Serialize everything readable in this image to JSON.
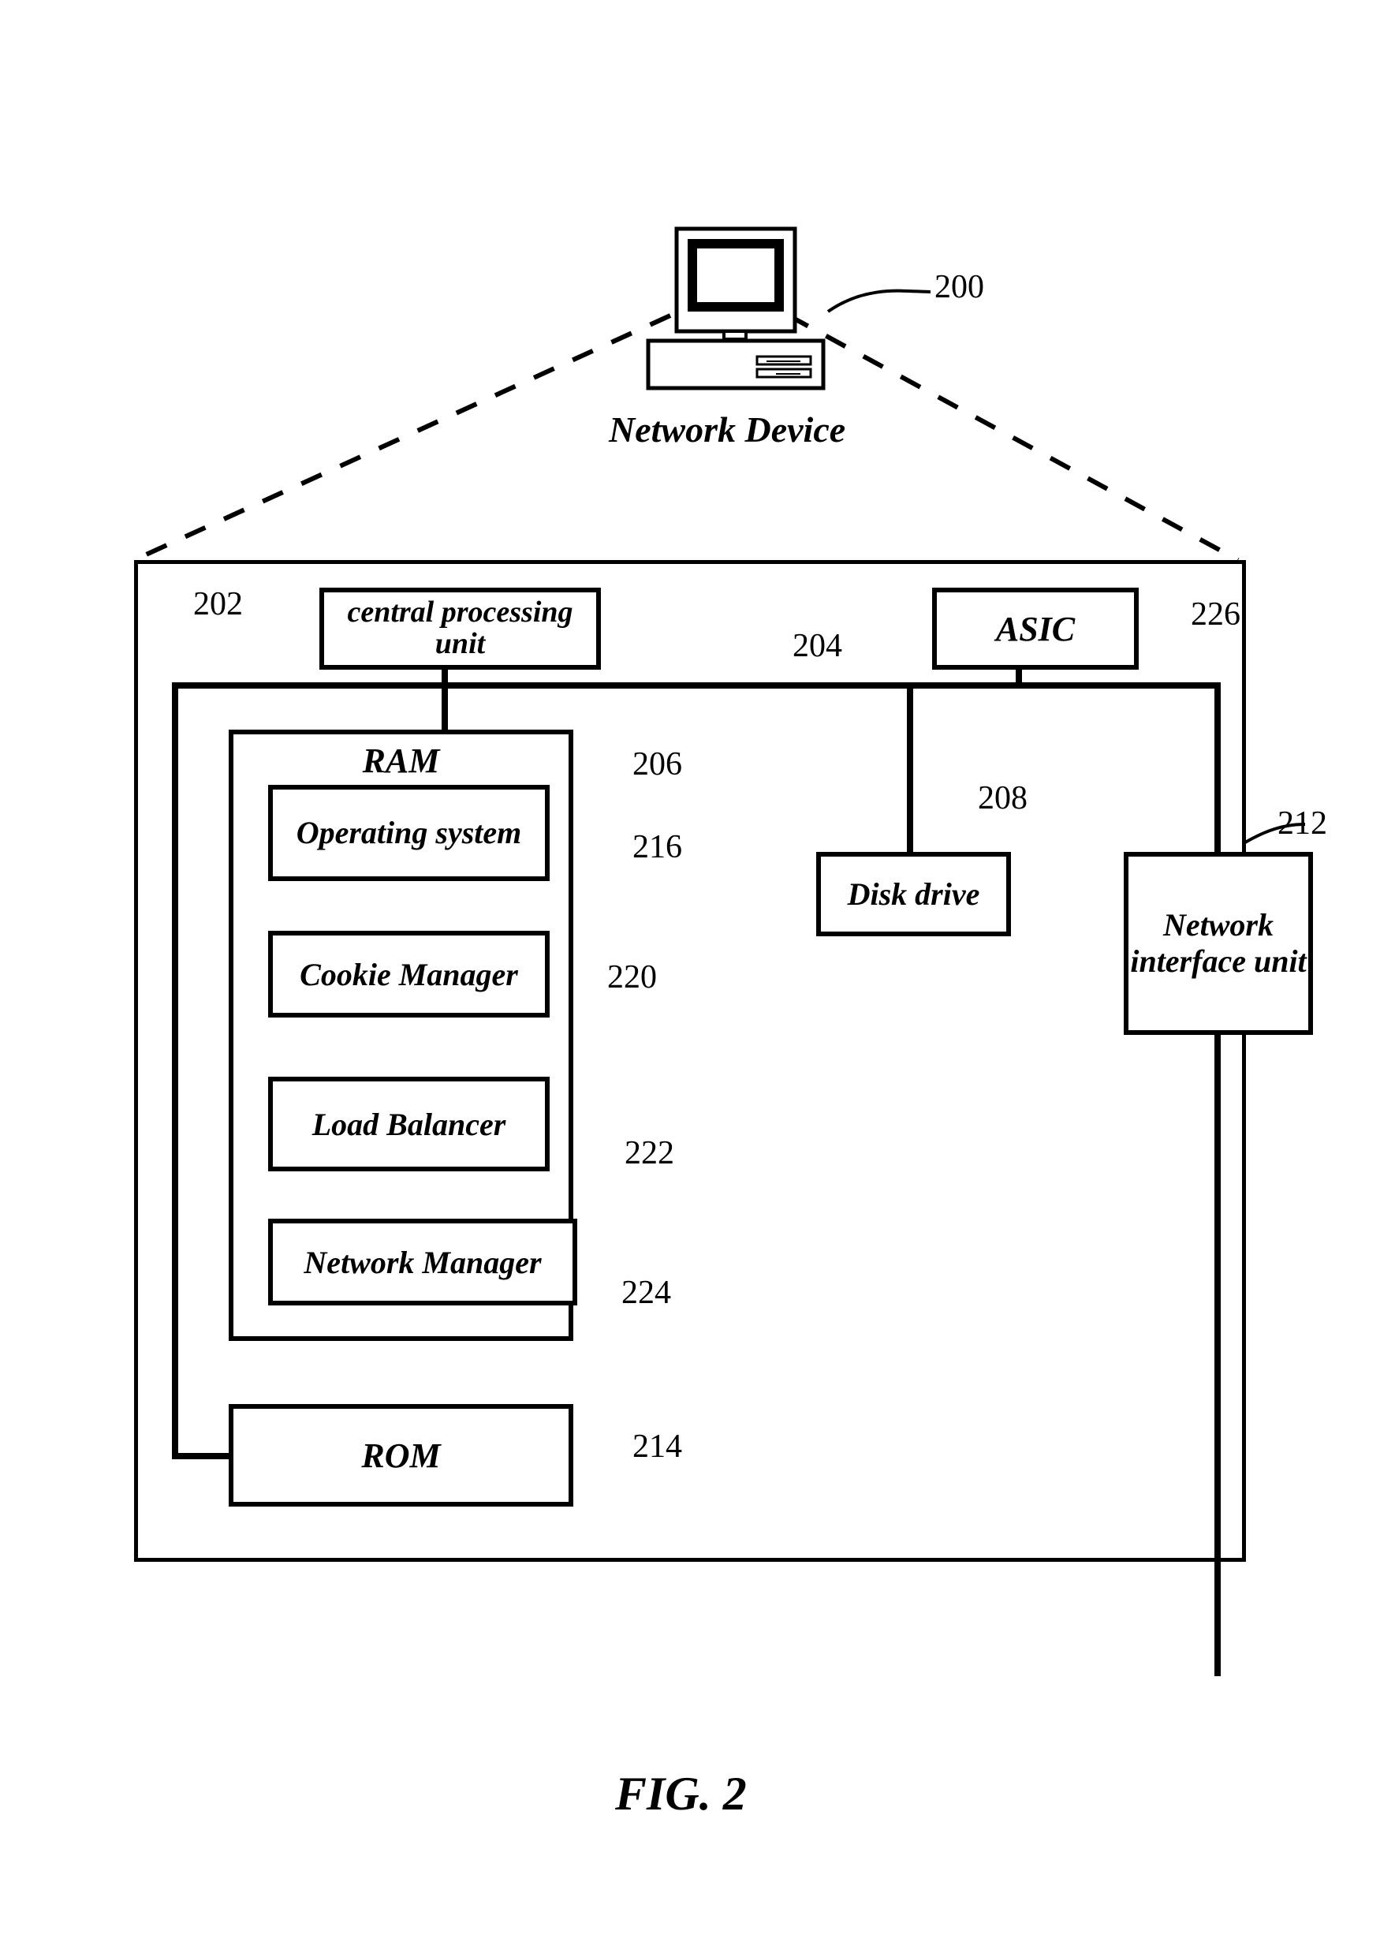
{
  "figure": "FIG. 2",
  "device_label": "Network Device",
  "refs": {
    "r200": "200",
    "r202": "202",
    "r204": "204",
    "r206": "206",
    "r208": "208",
    "r212": "212",
    "r214": "214",
    "r216": "216",
    "r220": "220",
    "r222": "222",
    "r224": "224",
    "r226": "226"
  },
  "blocks": {
    "cpu": "central processing unit",
    "asic": "ASIC",
    "ram": "RAM",
    "os": "Operating system",
    "cookie": "Cookie Manager",
    "lb": "Load Balancer",
    "nm": "Network Manager",
    "rom": "ROM",
    "disk": "Disk drive",
    "niu": "Network interface unit"
  }
}
